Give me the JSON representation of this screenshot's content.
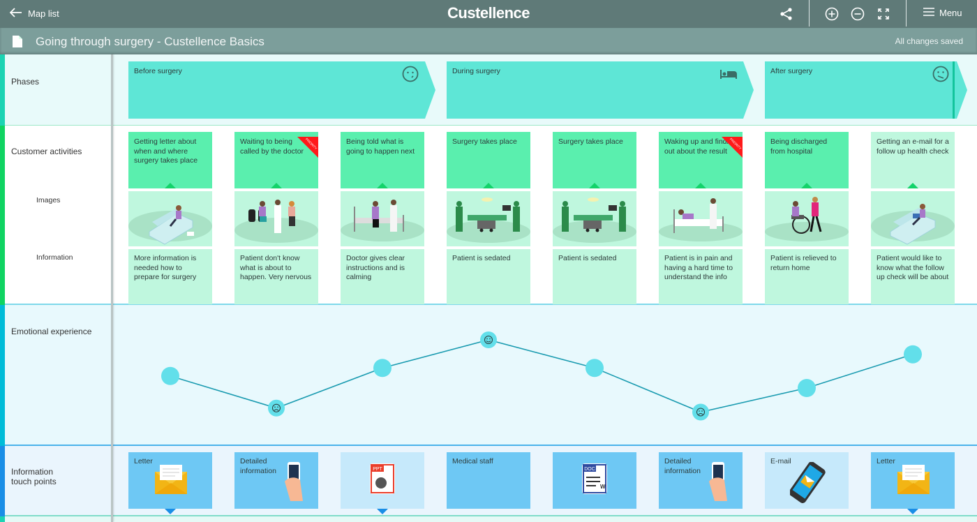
{
  "topbar": {
    "back_label": "Map list",
    "brand": "Custellence",
    "icons": [
      "share-icon",
      "zoom-in-icon",
      "zoom-out-icon",
      "fullscreen-icon"
    ],
    "menu_label": "Menu"
  },
  "subbar": {
    "title": "Going through surgery - Custellence Basics",
    "status": "All changes saved"
  },
  "lanes": {
    "phases": "Phases",
    "activities": "Customer activities",
    "images": "Images",
    "information": "Information",
    "emotional": "Emotional experience",
    "touchpoints_line1": "Information",
    "touchpoints_line2": "touch points"
  },
  "colors": {
    "phase": "#5ee6d6",
    "activity": "#5aefae",
    "activity_light": "#bff7de",
    "touchpoint": "#6ec8f4",
    "touchpoint_light": "#c6e9fb",
    "emotion_line": "#1a9bb0",
    "emotion_dot": "#62dfea",
    "priority": "#ff1a1a"
  },
  "phases": [
    {
      "title": "Before surgery",
      "icon": "neutral-face-icon"
    },
    {
      "title": "During surgery",
      "icon": "hospital-bed-icon"
    },
    {
      "title": "After surgery",
      "icon": "uneasy-face-icon"
    }
  ],
  "activities": [
    {
      "text": "Getting letter about when and where surgery takes place",
      "priority": false,
      "light": false,
      "image": "woman on sofa reading letter",
      "info": "More information is needed how to prepare for surgery"
    },
    {
      "text": "Waiting to being called by the doctor",
      "priority": true,
      "light": false,
      "image": "patients in waiting room",
      "info": "Patient don't know what is about to happen. Very nervous"
    },
    {
      "text": "Being told what is going to happen next",
      "priority": false,
      "light": false,
      "image": "doctor talking to patient on bed",
      "info": "Doctor gives clear instructions and is calming"
    },
    {
      "text": "Surgery takes place",
      "priority": false,
      "light": false,
      "image": "surgeons operating",
      "info": "Patient is sedated"
    },
    {
      "text": "Surgery takes place",
      "priority": false,
      "light": false,
      "image": "surgeons operating",
      "info": "Patient is sedated"
    },
    {
      "text": "Waking up and finding out about the result",
      "priority": true,
      "light": false,
      "image": "patient in bed with doctor",
      "info": "Patient is in pain and having a hard time to understand the info"
    },
    {
      "text": "Being discharged from hospital",
      "priority": false,
      "light": false,
      "image": "patient in wheelchair pushed home",
      "info": "Patient is relieved to return home"
    },
    {
      "text": "Getting an e-mail for a follow up health check",
      "priority": false,
      "light": true,
      "image": "woman on sofa with tablet",
      "info": "Patient would like to know what the follow up check will be about"
    }
  ],
  "priority_label": "PRIORITY",
  "emotions": [
    {
      "value": 0.55,
      "face": ""
    },
    {
      "value": 0.15,
      "face": "sad"
    },
    {
      "value": 0.65,
      "face": ""
    },
    {
      "value": 1.0,
      "face": "happy"
    },
    {
      "value": 0.65,
      "face": ""
    },
    {
      "value": 0.1,
      "face": "sad"
    },
    {
      "value": 0.4,
      "face": ""
    },
    {
      "value": 0.82,
      "face": ""
    }
  ],
  "touchpoints": [
    {
      "label": "Letter",
      "icon": "envelope-icon",
      "light": false,
      "arrow": true
    },
    {
      "label": "Detailed information",
      "icon": "phone-in-hand-icon",
      "light": false,
      "arrow": false
    },
    {
      "label": "",
      "icon": "ppt-file-icon",
      "light": true,
      "arrow": true
    },
    {
      "label": "Medical staff",
      "icon": "",
      "light": false,
      "arrow": false
    },
    {
      "label": "",
      "icon": "doc-file-icon",
      "light": false,
      "arrow": false
    },
    {
      "label": "Detailed information",
      "icon": "phone-in-hand-icon",
      "light": false,
      "arrow": false
    },
    {
      "label": "E-mail",
      "icon": "smartphone-email-icon",
      "light": true,
      "arrow": false
    },
    {
      "label": "Letter",
      "icon": "envelope-icon",
      "light": false,
      "arrow": true
    }
  ]
}
